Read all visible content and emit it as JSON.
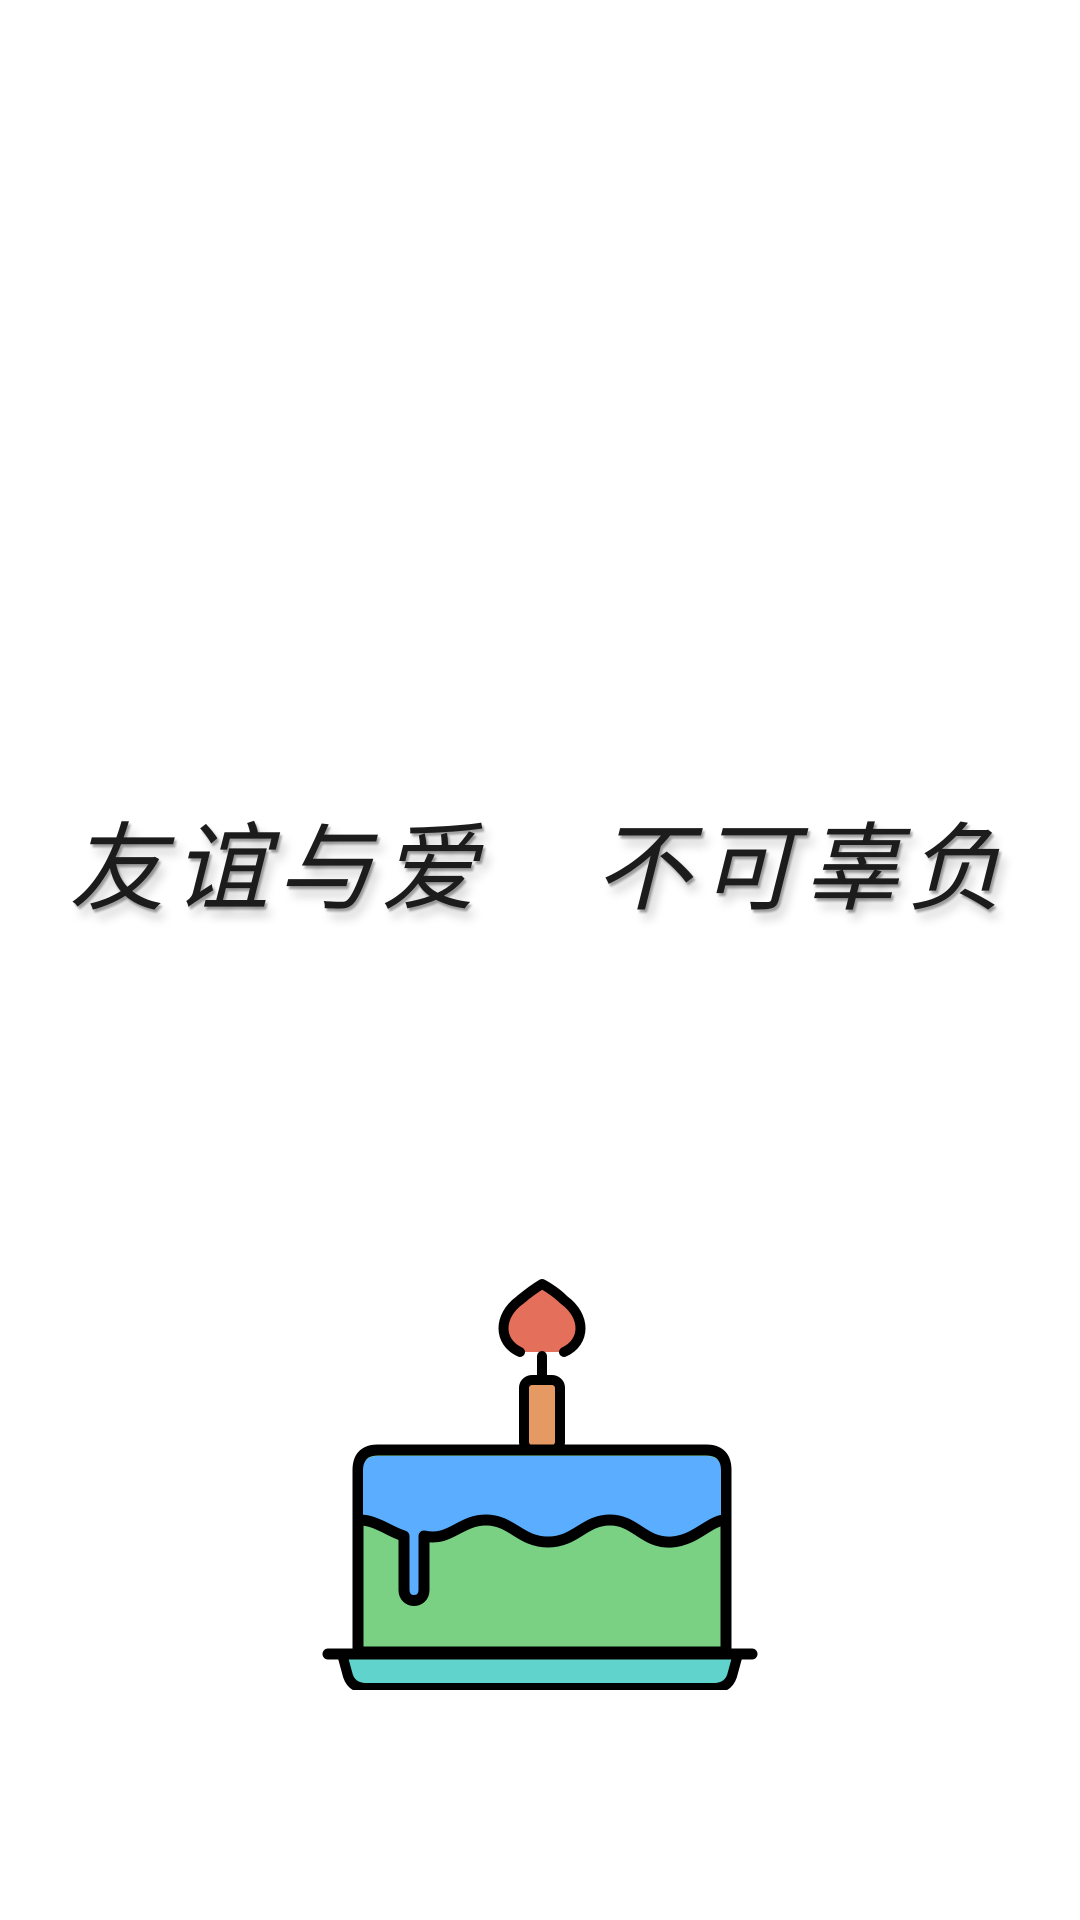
{
  "quote": {
    "part1": "友谊与爱",
    "part2": "不可辜负"
  },
  "illustration": {
    "icon": "birthday-cake-icon",
    "colors": {
      "outline": "#000000",
      "flame": "#E4705B",
      "candle": "#E59A63",
      "frosting": "#5BAEFF",
      "cake": "#7AD184",
      "plate": "#5FD3CC"
    }
  }
}
